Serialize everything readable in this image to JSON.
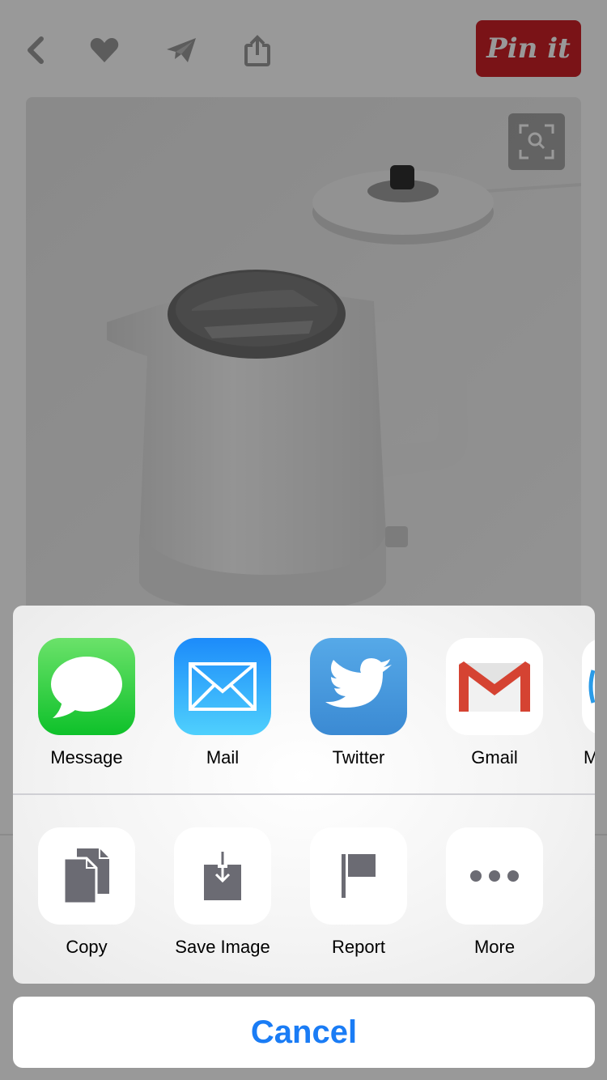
{
  "app": {
    "pin_label": "Pin it"
  },
  "share_sheet": {
    "apps": [
      {
        "label": "Message"
      },
      {
        "label": "Mail"
      },
      {
        "label": "Twitter"
      },
      {
        "label": "Gmail"
      },
      {
        "label": "M"
      }
    ],
    "actions": [
      {
        "label": "Copy"
      },
      {
        "label": "Save Image"
      },
      {
        "label": "Report"
      },
      {
        "label": "More"
      }
    ],
    "cancel_label": "Cancel"
  },
  "colors": {
    "pin_red": "#cb2027",
    "cancel_blue": "#1a7cf5",
    "action_icon_gray": "#6b6b73"
  }
}
